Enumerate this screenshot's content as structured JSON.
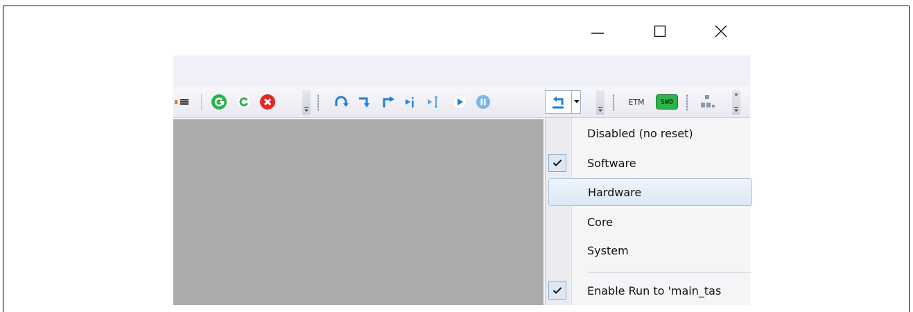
{
  "window": {
    "minimize_glyph": "—",
    "maximize_glyph": "☐",
    "close_glyph": "✕"
  },
  "toolbar": {
    "icons": [
      "windows-icon",
      "rebuild-icon",
      "build-icon",
      "stop-build-icon",
      "step-over-icon",
      "step-into-icon",
      "step-out-icon",
      "run-to-cursor-icon",
      "show-next-statement-icon",
      "run-icon",
      "stop-icon",
      "reset-icon",
      "reset-dropdown-arrow",
      "trace-icon",
      "swo-icon",
      "layout-icon"
    ],
    "etm_label": "ETM",
    "swo_label": "SWO",
    "overflow_glyph": "»"
  },
  "reset_menu": {
    "items": [
      {
        "label": "Disabled (no reset)",
        "checked": false,
        "highlighted": false
      },
      {
        "label": "Software",
        "checked": true,
        "highlighted": false
      },
      {
        "label": "Hardware",
        "checked": false,
        "highlighted": true
      },
      {
        "label": "Core",
        "checked": false,
        "highlighted": false
      },
      {
        "label": "System",
        "checked": false,
        "highlighted": false
      },
      {
        "label": "Enable Run to 'main_tas",
        "checked": true,
        "highlighted": false
      }
    ]
  },
  "colors": {
    "workspace": "#ababab",
    "menu_bg": "#f5f5f7",
    "highlight_border": "#a9c3e2",
    "green": "#2db34a",
    "red": "#e02a2a",
    "blue": "#1d7fd6"
  }
}
